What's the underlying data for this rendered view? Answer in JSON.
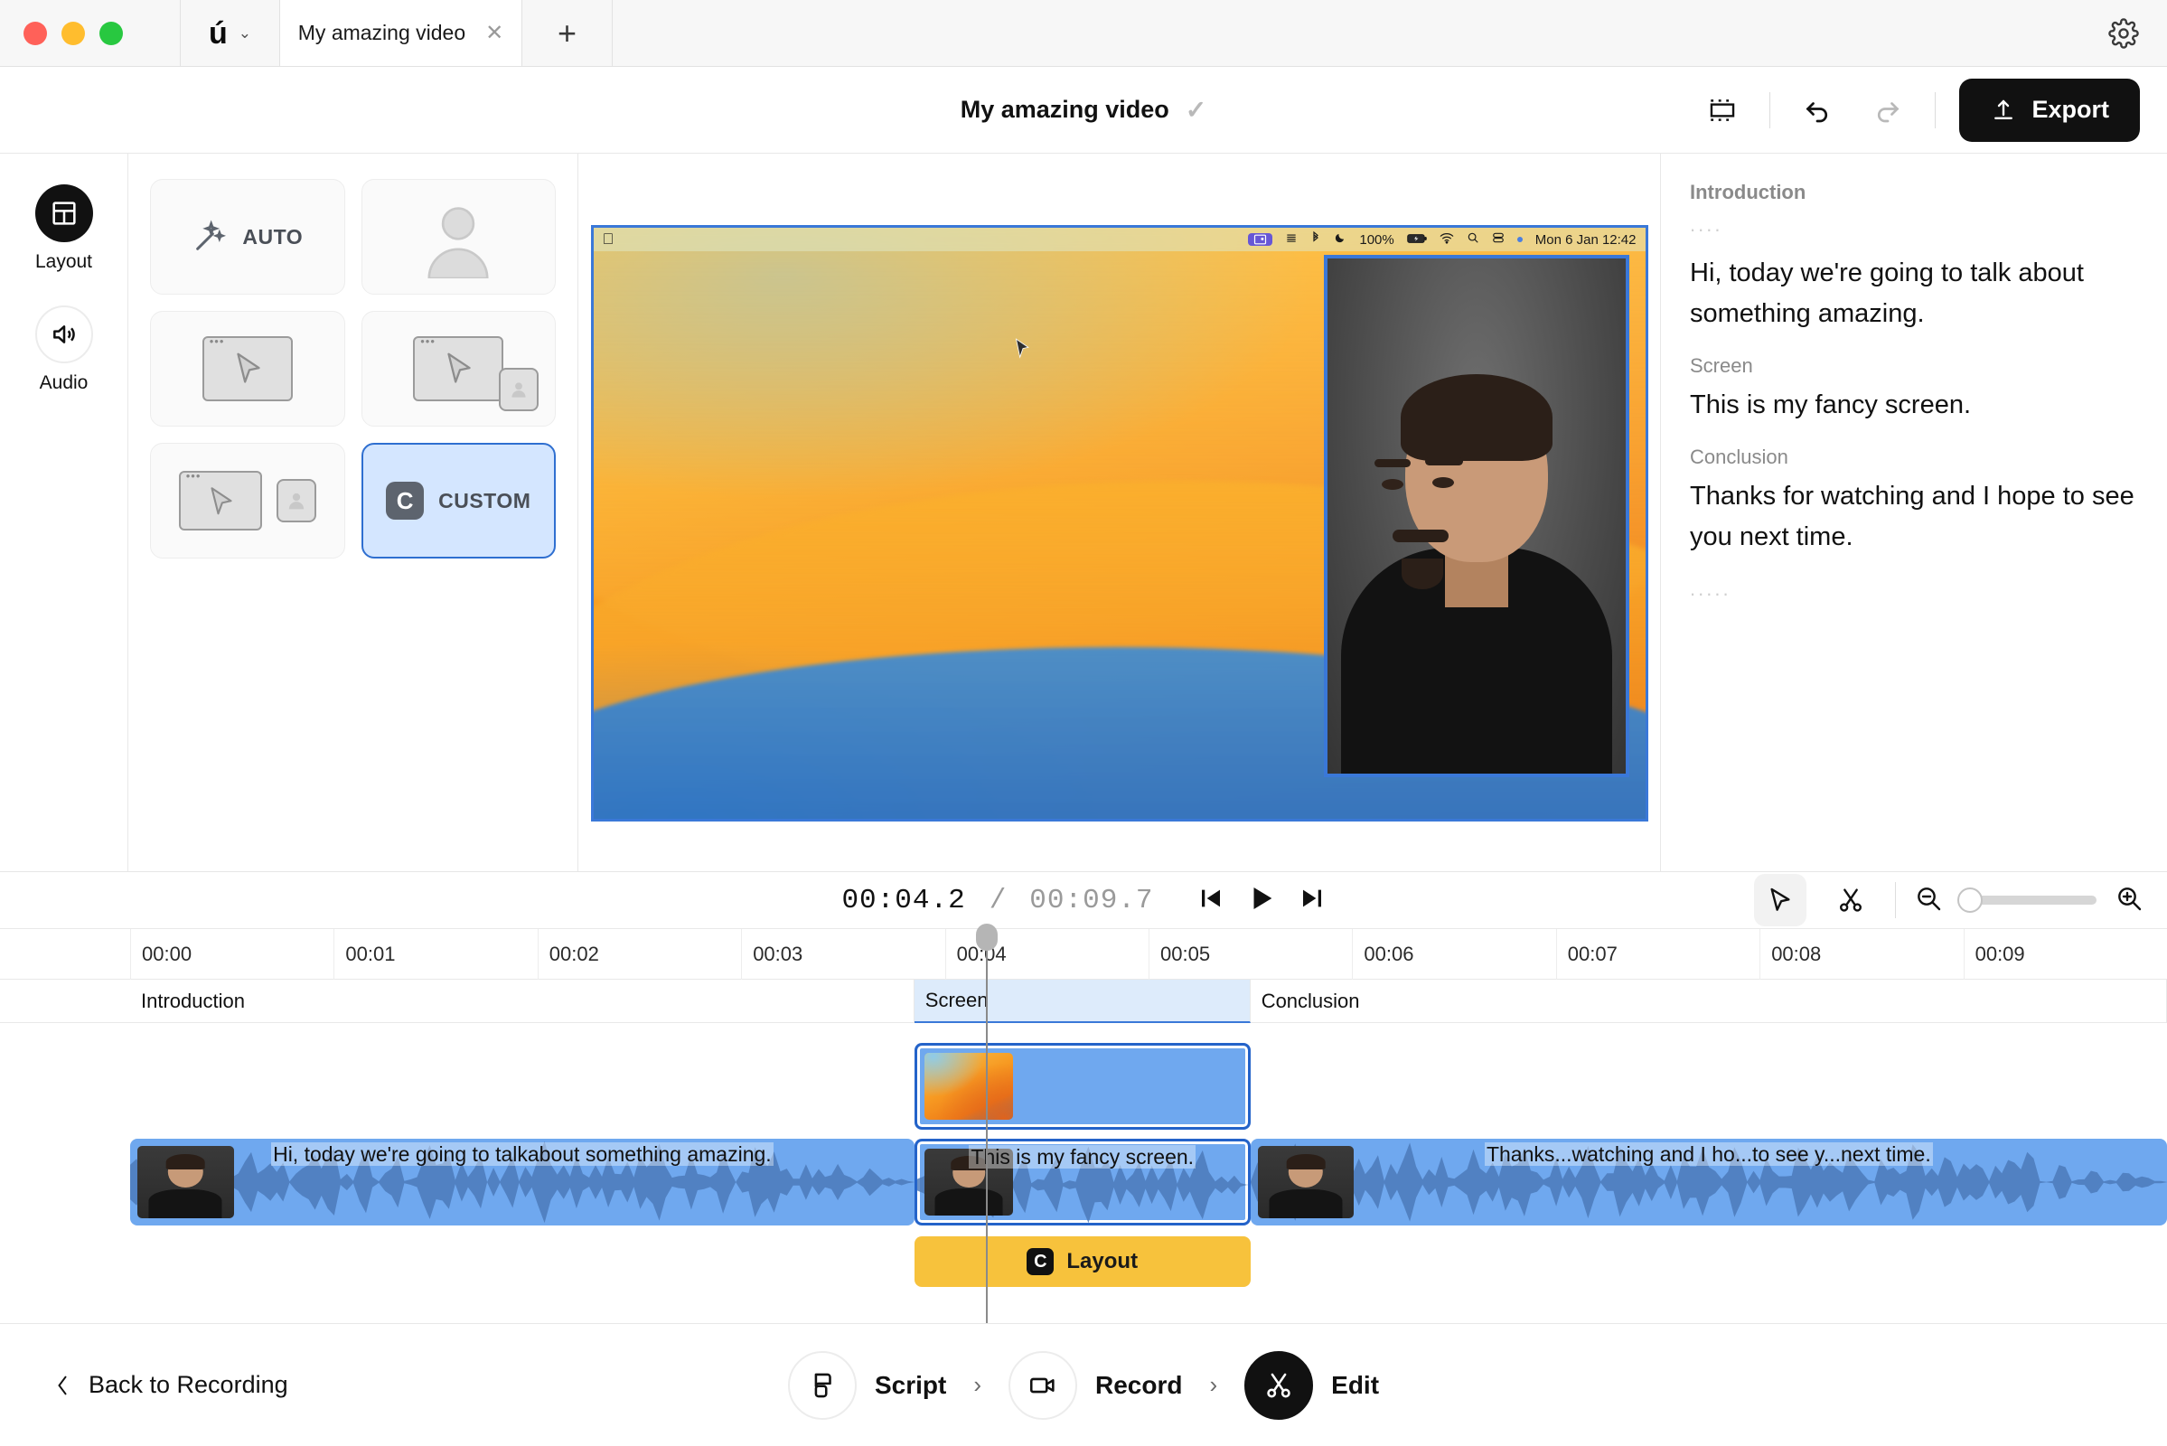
{
  "window": {
    "logo": "ú",
    "tab_title": "My amazing video",
    "tab_close_icon": "✕",
    "new_tab_icon": "+",
    "settings_icon": "gear-icon"
  },
  "header": {
    "title": "My amazing video",
    "saved_check": "✓",
    "aspect_icon": "aspect-ratio-icon",
    "undo_icon": "undo-icon",
    "redo_icon": "redo-icon",
    "export_label": "Export"
  },
  "rail": {
    "items": [
      {
        "label": "Layout",
        "icon": "layout-icon",
        "active": true
      },
      {
        "label": "Audio",
        "icon": "speaker-icon",
        "active": false
      }
    ]
  },
  "presets": [
    {
      "id": "auto",
      "label": "AUTO",
      "icon": "magic-wand-icon",
      "selected": false
    },
    {
      "id": "camera-only",
      "label": "",
      "icon": "person-icon",
      "selected": false
    },
    {
      "id": "screen-only",
      "label": "",
      "icon": "screen-icon",
      "selected": false
    },
    {
      "id": "screen-cam-corner",
      "label": "",
      "icon": "screen-camera-corner-icon",
      "selected": false
    },
    {
      "id": "screen-cam-side",
      "label": "",
      "icon": "screen-camera-side-icon",
      "selected": false
    },
    {
      "id": "custom",
      "label": "CUSTOM",
      "icon": "custom-badge-icon",
      "selected": true
    }
  ],
  "preview": {
    "menubar": {
      "apple": "",
      "battery_percent": "100%",
      "clock": "Mon 6 Jan  12:42",
      "icons": [
        "screen-share-icon",
        "stack-icon",
        "bluetooth-icon",
        "moon-icon",
        "battery-icon",
        "wifi-icon",
        "search-icon",
        "control-center-icon"
      ]
    },
    "cursor": "pointer-cursor"
  },
  "script": {
    "blocks": [
      {
        "label": "Introduction",
        "dots": "....",
        "text": "Hi, today we're going to talk about something amazing."
      },
      {
        "label": "Screen",
        "text": "This is my fancy screen."
      },
      {
        "label": "Conclusion",
        "text": "Thanks for watching and I hope to see you next time.",
        "dots": "....."
      }
    ]
  },
  "transport": {
    "current_time": "00:04.2",
    "separator": "/",
    "total_time": "00:09.7",
    "skip_back_icon": "skip-back-icon",
    "play_icon": "play-icon",
    "skip_forward_icon": "skip-forward-icon"
  },
  "timeline_tools": {
    "select_icon": "cursor-select-icon",
    "cut_icon": "scissors-icon",
    "zoom_out_icon": "zoom-out-icon",
    "zoom_in_icon": "zoom-in-icon",
    "zoom_value": 0
  },
  "timeline": {
    "ruler_ticks": [
      "00:00",
      "00:01",
      "00:02",
      "00:03",
      "00:04",
      "00:05",
      "00:06",
      "00:07",
      "00:08",
      "00:09"
    ],
    "playhead_time": "00:04.2",
    "chapters": [
      {
        "label": "Introduction",
        "start": 0,
        "end": 3.85,
        "active": false
      },
      {
        "label": "Screen",
        "start": 3.85,
        "end": 5.5,
        "active": true
      },
      {
        "label": "Conclusion",
        "start": 5.5,
        "end": 10,
        "active": false
      }
    ],
    "video_clips": [
      {
        "id": "screen-clip",
        "start": 3.85,
        "end": 5.5,
        "thumb": "wallpaper",
        "selected": true
      }
    ],
    "audio_clips": [
      {
        "id": "intro-clip",
        "start": 0,
        "end": 3.85,
        "caption": "Hi, today we're  going to talkabout something  amazing.",
        "selected": false
      },
      {
        "id": "screen-audio-clip",
        "start": 3.85,
        "end": 5.5,
        "caption": "This is my  fancy screen.",
        "selected": true
      },
      {
        "id": "conclusion-clip",
        "start": 5.5,
        "end": 10,
        "caption": "Thanks...watching and I ho...to see y...next time.",
        "selected": false
      }
    ],
    "layout_bars": [
      {
        "label": "Layout",
        "badge": "C",
        "start": 3.85,
        "end": 5.5
      }
    ]
  },
  "bottom": {
    "back_label": "Back to Recording",
    "back_icon": "chevron-left-icon",
    "steps": [
      {
        "label": "Script",
        "icon": "script-icon",
        "active": false
      },
      {
        "label": "Record",
        "icon": "camera-icon",
        "active": false
      },
      {
        "label": "Edit",
        "icon": "scissors-icon",
        "active": true
      }
    ],
    "step_chevron": "›"
  },
  "colors": {
    "accent_blue": "#2463c9",
    "clip_blue": "#6fa8ef",
    "chapter_blue": "#ddebfb",
    "layout_yellow": "#f7c23c",
    "dark": "#111111"
  }
}
